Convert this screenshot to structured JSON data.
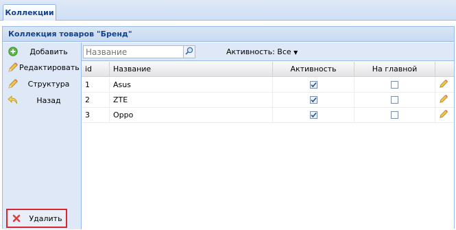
{
  "tabs": [
    {
      "label": "Коллекции"
    }
  ],
  "panel": {
    "title": "Коллекция товаров \"Бренд\""
  },
  "sidebar": {
    "buttons": [
      {
        "label": "Добавить",
        "icon": "add-icon"
      },
      {
        "label": "Редактировать",
        "icon": "pencil-icon"
      },
      {
        "label": "Структура",
        "icon": "pencil-icon"
      },
      {
        "label": "Назад",
        "icon": "back-arrow-icon"
      }
    ],
    "delete": {
      "label": "Удалить",
      "icon": "close-icon"
    }
  },
  "search": {
    "placeholder": "Название"
  },
  "filter": {
    "label": "Активность: Все"
  },
  "grid": {
    "columns": [
      "id",
      "Название",
      "Активность",
      "На главной"
    ],
    "rows": [
      {
        "id": "1",
        "name": "Asus",
        "active": true,
        "on_main": false
      },
      {
        "id": "2",
        "name": "ZTE",
        "active": true,
        "on_main": false
      },
      {
        "id": "3",
        "name": "Oppo",
        "active": true,
        "on_main": false
      }
    ]
  },
  "colors": {
    "header_text": "#15428b",
    "highlight_border": "#d9262e",
    "panel_bg": "#dfe8f6"
  }
}
